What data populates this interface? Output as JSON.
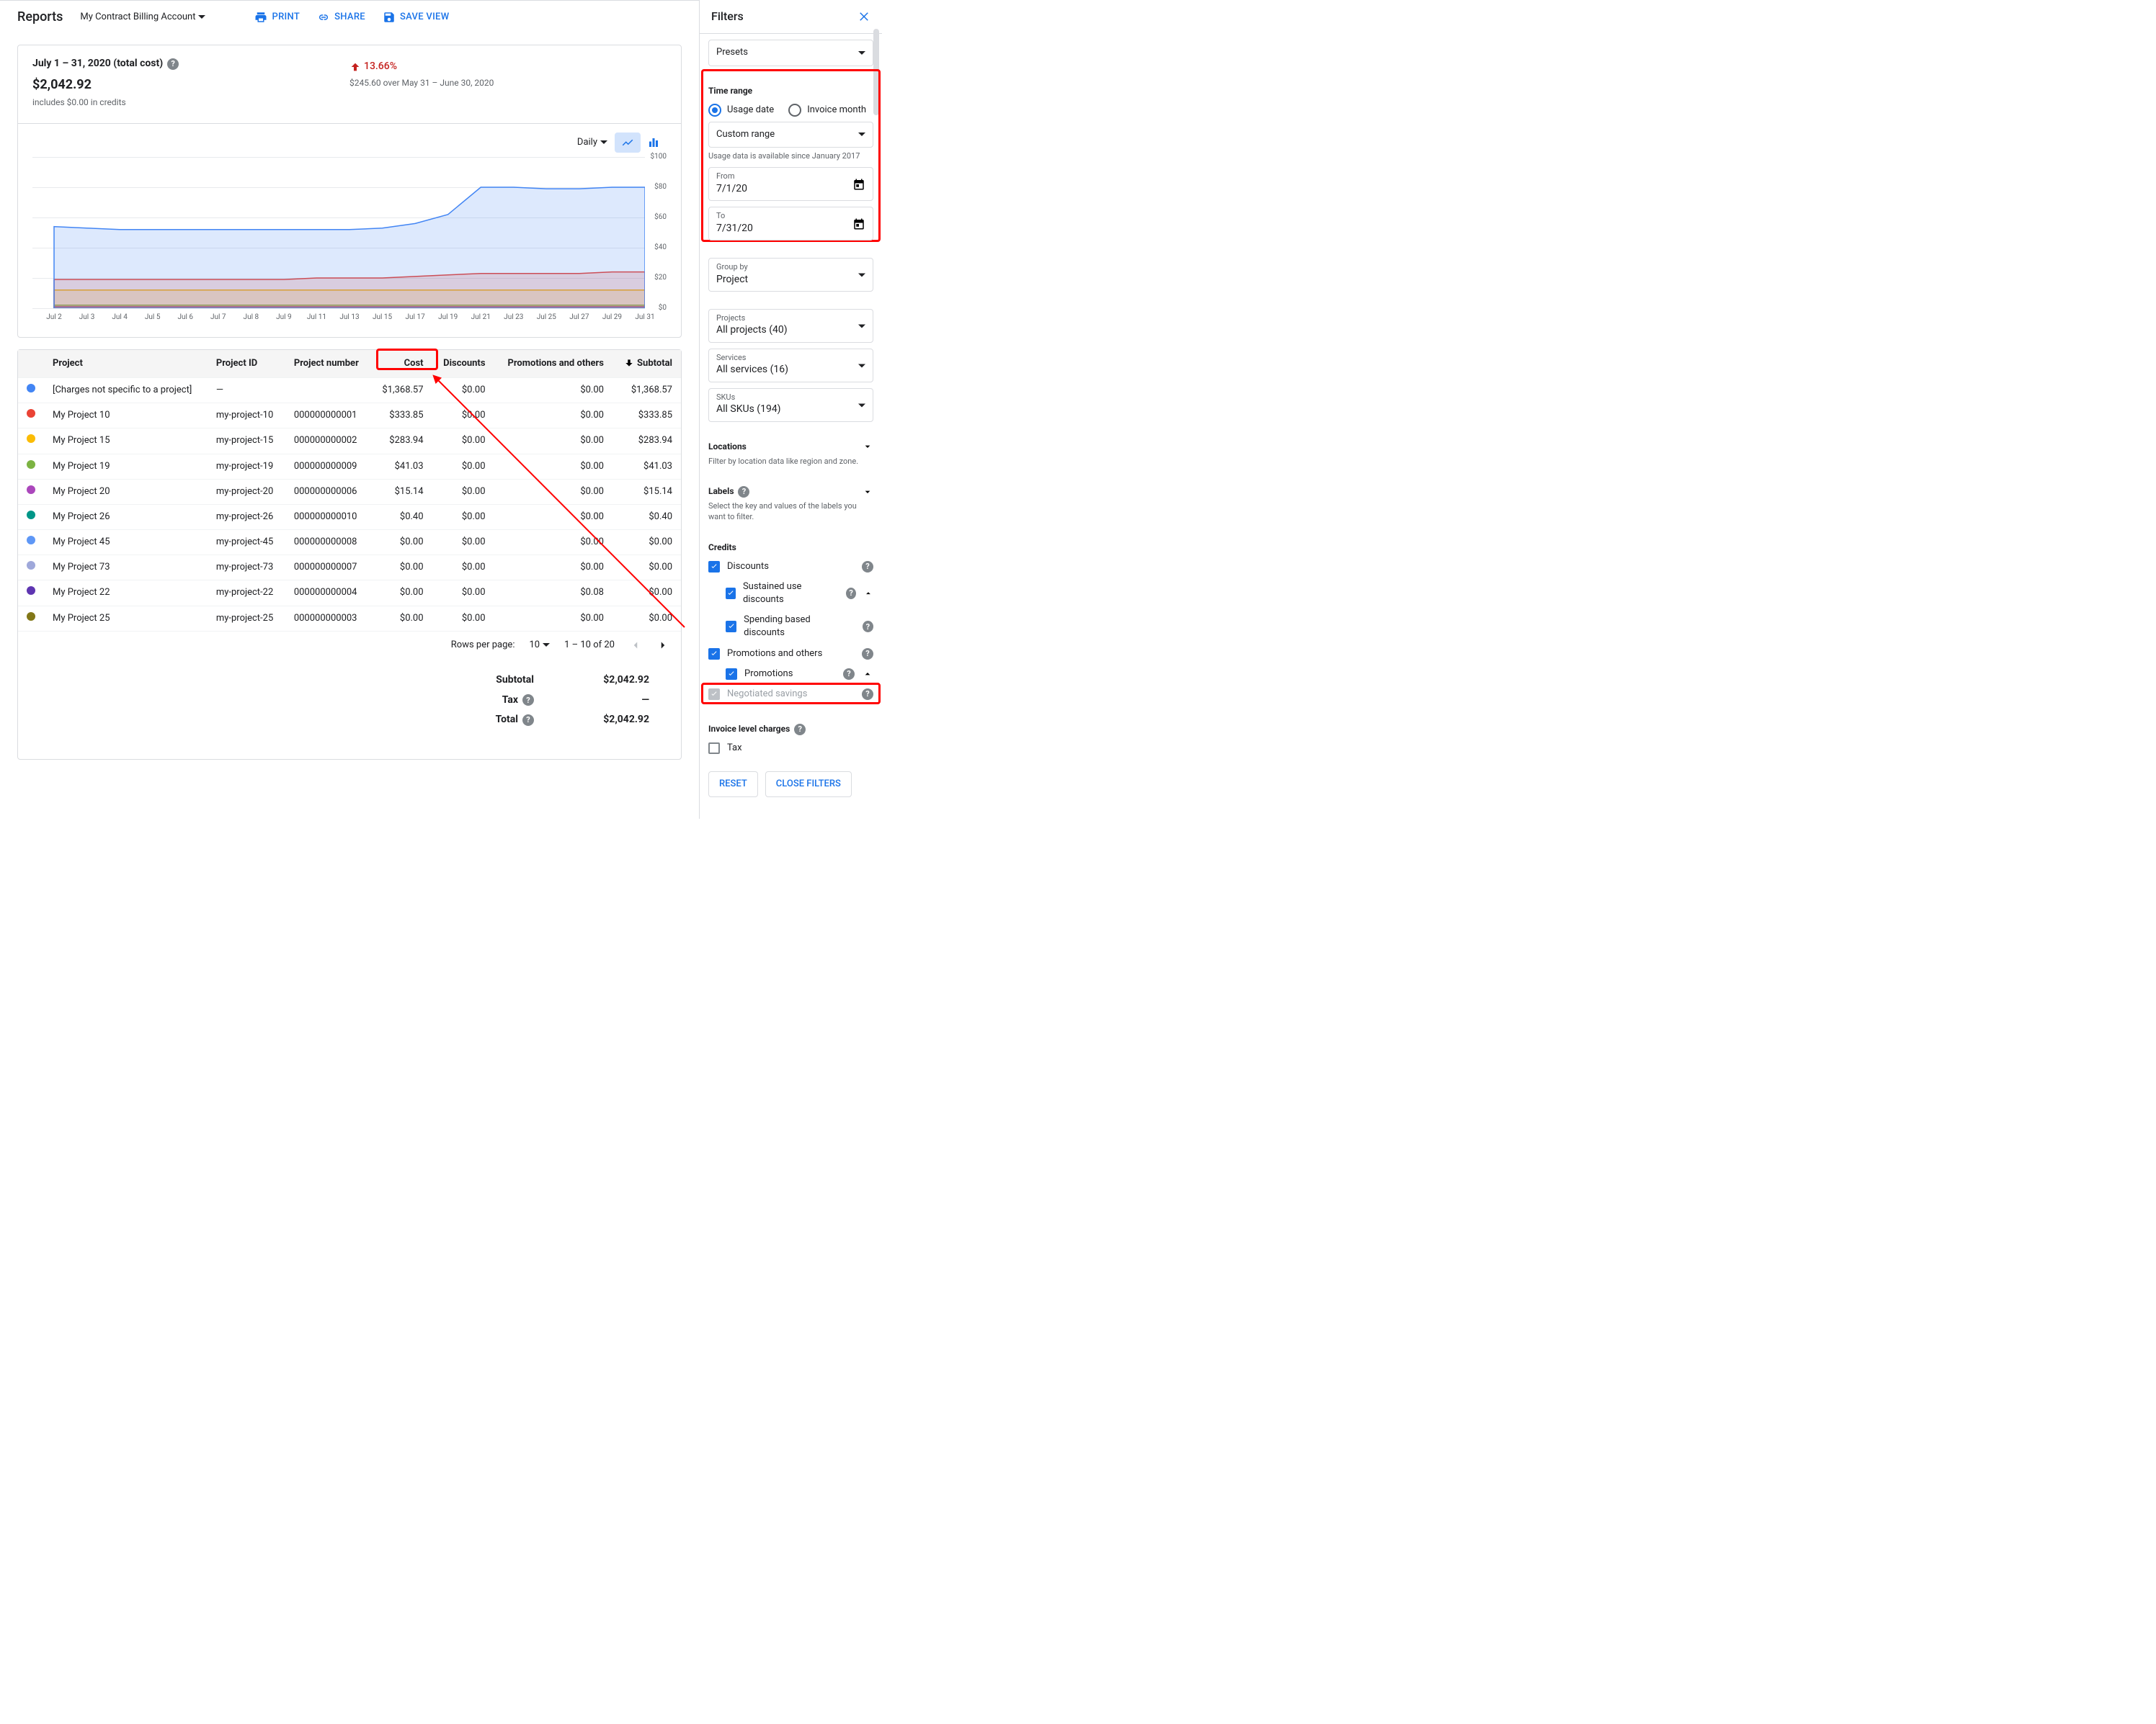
{
  "header": {
    "title": "Reports",
    "account": "My Contract Billing Account",
    "actions": {
      "print": "PRINT",
      "share": "SHARE",
      "save": "SAVE VIEW"
    }
  },
  "summary": {
    "range_label": "July 1 – 31, 2020 (total cost)",
    "total": "$2,042.92",
    "credits_note": "includes $0.00 in credits",
    "delta_pct": "13.66%",
    "delta_detail": "$245.60 over May 31 – June 30, 2020"
  },
  "chart_controls": {
    "granularity": "Daily"
  },
  "chart_data": {
    "type": "area",
    "ylim": [
      0,
      100
    ],
    "yticks": [
      "$100",
      "$80",
      "$60",
      "$40",
      "$20",
      "$0"
    ],
    "x_categories": [
      "Jul 2",
      "Jul 3",
      "Jul 4",
      "Jul 5",
      "Jul 6",
      "Jul 7",
      "Jul 8",
      "Jul 9",
      "Jul 11",
      "Jul 13",
      "Jul 15",
      "Jul 17",
      "Jul 19",
      "Jul 21",
      "Jul 23",
      "Jul 25",
      "Jul 27",
      "Jul 29",
      "Jul 31"
    ],
    "series": [
      {
        "name": "[Charges not specific to a project]",
        "color": "#4285f4",
        "values": [
          54,
          53,
          52,
          52,
          52,
          52,
          52,
          52,
          52,
          52,
          53,
          56,
          62,
          80,
          80,
          79,
          79,
          80,
          80
        ]
      },
      {
        "name": "My Project 10",
        "color": "#ea4335",
        "values": [
          19,
          19,
          19,
          19,
          19,
          19,
          19,
          19,
          20,
          20,
          20,
          21,
          22,
          23,
          23,
          23,
          23,
          24,
          24
        ]
      },
      {
        "name": "My Project 15",
        "color": "#fbbc04",
        "values": [
          12,
          12,
          12,
          12,
          12,
          12,
          12,
          12,
          12,
          12,
          12,
          12,
          12,
          12,
          12,
          12,
          12,
          12,
          12
        ]
      },
      {
        "name": "My Project 19",
        "color": "#7cb342",
        "values": [
          2,
          2,
          2,
          2,
          2,
          2,
          2,
          2,
          2,
          2,
          2,
          2,
          2,
          2,
          2,
          2,
          2,
          2,
          2
        ]
      },
      {
        "name": "My Project 20",
        "color": "#9c27b0",
        "values": [
          1,
          1,
          1,
          1,
          1,
          1,
          1,
          1,
          1,
          1,
          1,
          1,
          1,
          1,
          1,
          1,
          1,
          1,
          1
        ]
      },
      {
        "name": "My Project 26",
        "color": "#009688",
        "values": [
          0,
          0,
          0,
          0,
          0,
          0,
          0,
          0,
          0,
          0,
          0,
          0,
          0,
          0,
          0,
          0,
          0,
          0,
          0
        ]
      }
    ]
  },
  "table": {
    "headers": {
      "project": "Project",
      "project_id": "Project ID",
      "project_number": "Project number",
      "cost": "Cost",
      "discounts": "Discounts",
      "promo": "Promotions and others",
      "subtotal_hdr": "Subtotal"
    },
    "rows": [
      {
        "color": "#4285f4",
        "project": "[Charges not specific to a project]",
        "id": "—",
        "number": "",
        "cost": "$1,368.57",
        "discounts": "$0.00",
        "promo": "$0.00",
        "subtotal": "$1,368.57"
      },
      {
        "color": "#ea4335",
        "project": "My Project 10",
        "id": "my-project-10",
        "number": "000000000001",
        "cost": "$333.85",
        "discounts": "$0.00",
        "promo": "$0.00",
        "subtotal": "$333.85"
      },
      {
        "color": "#fbbc04",
        "project": "My Project 15",
        "id": "my-project-15",
        "number": "000000000002",
        "cost": "$283.94",
        "discounts": "$0.00",
        "promo": "$0.00",
        "subtotal": "$283.94"
      },
      {
        "color": "#7cb342",
        "project": "My Project 19",
        "id": "my-project-19",
        "number": "000000000009",
        "cost": "$41.03",
        "discounts": "$0.00",
        "promo": "$0.00",
        "subtotal": "$41.03"
      },
      {
        "color": "#ab47bc",
        "project": "My Project 20",
        "id": "my-project-20",
        "number": "000000000006",
        "cost": "$15.14",
        "discounts": "$0.00",
        "promo": "$0.00",
        "subtotal": "$15.14"
      },
      {
        "color": "#009688",
        "project": "My Project 26",
        "id": "my-project-26",
        "number": "000000000010",
        "cost": "$0.40",
        "discounts": "$0.00",
        "promo": "$0.00",
        "subtotal": "$0.40"
      },
      {
        "color": "#5e97f6",
        "project": "My Project 45",
        "id": "my-project-45",
        "number": "000000000008",
        "cost": "$0.00",
        "discounts": "$0.00",
        "promo": "$0.00",
        "subtotal": "$0.00"
      },
      {
        "color": "#9fa8da",
        "project": "My Project 73",
        "id": "my-project-73",
        "number": "000000000007",
        "cost": "$0.00",
        "discounts": "$0.00",
        "promo": "$0.00",
        "subtotal": "$0.00"
      },
      {
        "color": "#5e35b1",
        "project": "My Project 22",
        "id": "my-project-22",
        "number": "000000000004",
        "cost": "$0.00",
        "discounts": "$0.00",
        "promo": "$0.08",
        "subtotal": "$0.00"
      },
      {
        "color": "#827717",
        "project": "My Project 25",
        "id": "my-project-25",
        "number": "000000000003",
        "cost": "$0.00",
        "discounts": "$0.00",
        "promo": "$0.00",
        "subtotal": "$0.00"
      }
    ],
    "pager": {
      "rpp_label": "Rows per page:",
      "rpp": "10",
      "range": "1 – 10 of 20"
    },
    "totals": {
      "subtotal_lbl": "Subtotal",
      "subtotal": "$2,042.92",
      "tax_lbl": "Tax",
      "tax": "—",
      "total_lbl": "Total",
      "total": "$2,042.92"
    }
  },
  "filters": {
    "title": "Filters",
    "presets": "Presets",
    "time_range": {
      "title": "Time range",
      "usage": "Usage date",
      "invoice": "Invoice month",
      "range_mode": "Custom range",
      "hint": "Usage data is available since January 2017",
      "from_lbl": "From",
      "from": "7/1/20",
      "to_lbl": "To",
      "to": "7/31/20"
    },
    "group_by": {
      "label": "Group by",
      "value": "Project"
    },
    "projects": {
      "label": "Projects",
      "value": "All projects (40)"
    },
    "services": {
      "label": "Services",
      "value": "All services (16)"
    },
    "skus": {
      "label": "SKUs",
      "value": "All SKUs (194)"
    },
    "locations": {
      "title": "Locations",
      "hint": "Filter by location data like region and zone."
    },
    "labels": {
      "title": "Labels",
      "hint": "Select the key and values of the labels you want to filter."
    },
    "credits": {
      "title": "Credits",
      "discounts": "Discounts",
      "sud": "Sustained use discounts",
      "sbd": "Spending based discounts",
      "promo": "Promotions and others",
      "promotions": "Promotions",
      "neg": "Negotiated savings"
    },
    "invoice": {
      "title": "Invoice level charges",
      "tax": "Tax"
    },
    "reset": "RESET",
    "close": "CLOSE FILTERS"
  }
}
